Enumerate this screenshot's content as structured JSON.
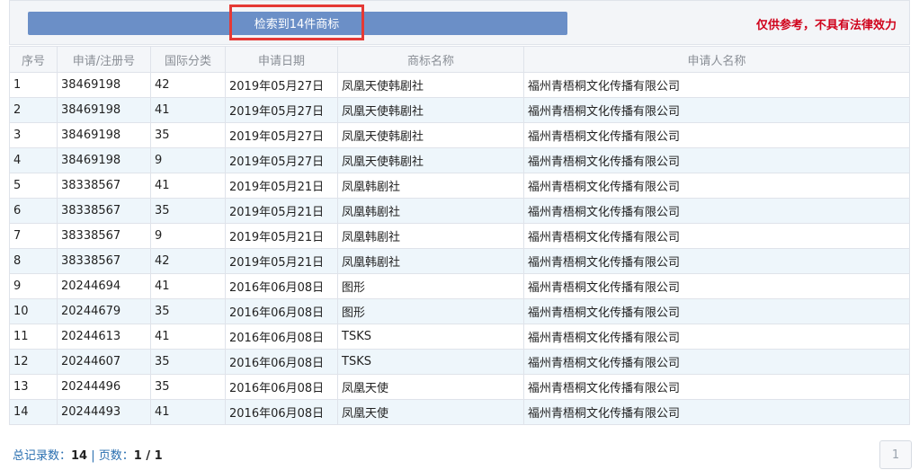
{
  "header": {
    "result_label": "检索到14件商标",
    "disclaimer": "仅供参考，不具有法律效力"
  },
  "table": {
    "columns": [
      "序号",
      "申请/注册号",
      "国际分类",
      "申请日期",
      "商标名称",
      "申请人名称"
    ],
    "rows": [
      {
        "idx": "1",
        "reg": "38469198",
        "cls": "42",
        "date": "2019年05月27日",
        "name": "凤凰天使韩剧社",
        "applicant": "福州青梧桐文化传播有限公司"
      },
      {
        "idx": "2",
        "reg": "38469198",
        "cls": "41",
        "date": "2019年05月27日",
        "name": "凤凰天使韩剧社",
        "applicant": "福州青梧桐文化传播有限公司"
      },
      {
        "idx": "3",
        "reg": "38469198",
        "cls": "35",
        "date": "2019年05月27日",
        "name": "凤凰天使韩剧社",
        "applicant": "福州青梧桐文化传播有限公司"
      },
      {
        "idx": "4",
        "reg": "38469198",
        "cls": "9",
        "date": "2019年05月27日",
        "name": "凤凰天使韩剧社",
        "applicant": "福州青梧桐文化传播有限公司"
      },
      {
        "idx": "5",
        "reg": "38338567",
        "cls": "41",
        "date": "2019年05月21日",
        "name": "凤凰韩剧社",
        "applicant": "福州青梧桐文化传播有限公司"
      },
      {
        "idx": "6",
        "reg": "38338567",
        "cls": "35",
        "date": "2019年05月21日",
        "name": "凤凰韩剧社",
        "applicant": "福州青梧桐文化传播有限公司"
      },
      {
        "idx": "7",
        "reg": "38338567",
        "cls": "9",
        "date": "2019年05月21日",
        "name": "凤凰韩剧社",
        "applicant": "福州青梧桐文化传播有限公司"
      },
      {
        "idx": "8",
        "reg": "38338567",
        "cls": "42",
        "date": "2019年05月21日",
        "name": "凤凰韩剧社",
        "applicant": "福州青梧桐文化传播有限公司"
      },
      {
        "idx": "9",
        "reg": "20244694",
        "cls": "41",
        "date": "2016年06月08日",
        "name": "图形",
        "applicant": "福州青梧桐文化传播有限公司"
      },
      {
        "idx": "10",
        "reg": "20244679",
        "cls": "35",
        "date": "2016年06月08日",
        "name": "图形",
        "applicant": "福州青梧桐文化传播有限公司"
      },
      {
        "idx": "11",
        "reg": "20244613",
        "cls": "41",
        "date": "2016年06月08日",
        "name": "TSKS",
        "applicant": "福州青梧桐文化传播有限公司"
      },
      {
        "idx": "12",
        "reg": "20244607",
        "cls": "35",
        "date": "2016年06月08日",
        "name": "TSKS",
        "applicant": "福州青梧桐文化传播有限公司"
      },
      {
        "idx": "13",
        "reg": "20244496",
        "cls": "35",
        "date": "2016年06月08日",
        "name": "凤凰天使",
        "applicant": "福州青梧桐文化传播有限公司"
      },
      {
        "idx": "14",
        "reg": "20244493",
        "cls": "41",
        "date": "2016年06月08日",
        "name": "凤凰天使",
        "applicant": "福州青梧桐文化传播有限公司"
      }
    ]
  },
  "footer": {
    "total_label": "总记录数：",
    "total_value": "14",
    "separator": " | ",
    "pages_label": "页数：",
    "pages_value": "1 / 1",
    "page_button": "1"
  },
  "colors": {
    "accent": "#6b8fc7",
    "highlight_border": "#e53935",
    "disclaimer": "#d0021b",
    "link": "#2a6fb0",
    "row_alt": "#eef6fb"
  }
}
